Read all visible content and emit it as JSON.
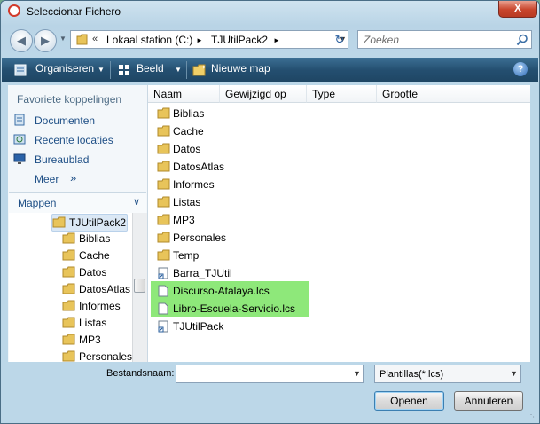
{
  "window": {
    "title": "Seleccionar Fichero",
    "close_label": "X"
  },
  "address": {
    "separator": "«",
    "segments": [
      "Lokaal station (C:)",
      "TJUtilPack2"
    ],
    "arrows": [
      "►",
      "►"
    ]
  },
  "search": {
    "placeholder": "Zoeken"
  },
  "toolbar": {
    "organize": "Organiseren",
    "view": "Beeld",
    "new_folder": "Nieuwe map",
    "help": "?"
  },
  "sidebar": {
    "favorites_title": "Favoriete koppelingen",
    "favorites": [
      "Documenten",
      "Recente locaties",
      "Bureaublad",
      "Meer"
    ],
    "more_arrow": "»",
    "folders_title": "Mappen",
    "tree": [
      "TJUtilPack2",
      "Biblias",
      "Cache",
      "Datos",
      "DatosAtlas",
      "Informes",
      "Listas",
      "MP3",
      "Personales"
    ]
  },
  "columns": [
    "Naam",
    "Gewijzigd op",
    "Type",
    "Grootte"
  ],
  "files": [
    {
      "name": "Biblias",
      "kind": "folder"
    },
    {
      "name": "Cache",
      "kind": "folder"
    },
    {
      "name": "Datos",
      "kind": "folder"
    },
    {
      "name": "DatosAtlas",
      "kind": "folder"
    },
    {
      "name": "Informes",
      "kind": "folder"
    },
    {
      "name": "Listas",
      "kind": "folder"
    },
    {
      "name": "MP3",
      "kind": "folder"
    },
    {
      "name": "Personales",
      "kind": "folder"
    },
    {
      "name": "Temp",
      "kind": "folder"
    },
    {
      "name": "Barra_TJUtil",
      "kind": "shortcut"
    },
    {
      "name": "Discurso-Atalaya.lcs",
      "kind": "file",
      "highlighted": true
    },
    {
      "name": "Libro-Escuela-Servicio.lcs",
      "kind": "file",
      "highlighted": true
    },
    {
      "name": "TJUtilPack",
      "kind": "shortcut"
    }
  ],
  "bottom": {
    "filename_label": "Bestandsnaam:",
    "filename_value": "",
    "filter_value": "Plantillas(*.lcs)",
    "open_label": "Openen",
    "cancel_label": "Annuleren"
  },
  "colors": {
    "highlight": "#8ee87a",
    "toolbar": "#244f70",
    "link": "#1e4f86"
  }
}
